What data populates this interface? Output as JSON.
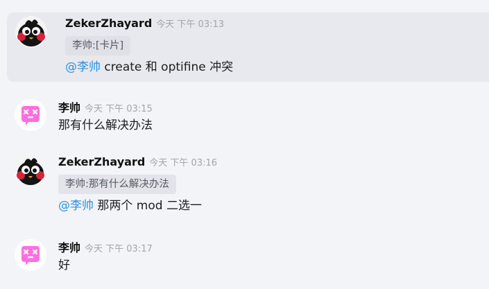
{
  "messages": [
    {
      "username": "ZekerZhayard",
      "timestamp": "今天 下午 03:13",
      "avatar": "black-bird-avatar",
      "quote": "李帅:[卡片]",
      "mention": "@李帅",
      "text": " create 和 optifine 冲突"
    },
    {
      "username": "李帅",
      "timestamp": "今天 下午 03:15",
      "avatar": "pink-dizzy-robot-avatar",
      "text": "那有什么解决办法"
    },
    {
      "username": "ZekerZhayard",
      "timestamp": "今天 下午 03:16",
      "avatar": "black-bird-avatar",
      "quote": "李帅:那有什么解决办法",
      "mention": "@李帅",
      "text": " 那两个 mod 二选一"
    },
    {
      "username": "李帅",
      "timestamp": "今天 下午 03:17",
      "avatar": "pink-dizzy-robot-avatar",
      "text": "好"
    }
  ],
  "colors": {
    "background": "#f3f4f8",
    "hover_background": "#e8e9ee",
    "quote_background": "#e0e1e6",
    "mention": "#2a8fe0",
    "timestamp": "#a2a4aa",
    "robot_pink": "#ff6fe0"
  }
}
